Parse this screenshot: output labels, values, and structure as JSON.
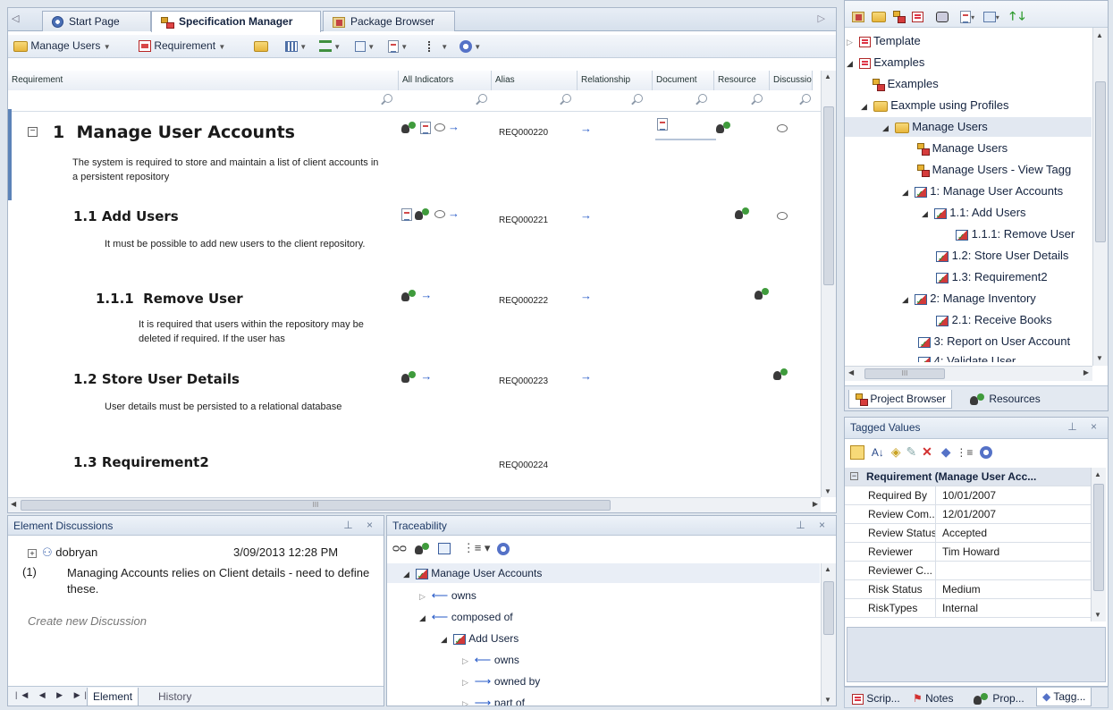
{
  "doc_tabs": {
    "start_page": "Start Page",
    "spec_manager": "Specification Manager",
    "package_browser": "Package Browser"
  },
  "spec_toolbar": {
    "manage_users": "Manage Users",
    "requirement": "Requirement"
  },
  "columns": {
    "requirement": "Requirement",
    "all_indicators": "All Indicators",
    "alias": "Alias",
    "relationship": "Relationship",
    "document": "Document",
    "resource": "Resource",
    "discussion": "Discussio"
  },
  "requirements": [
    {
      "number": "1",
      "title": "Manage User Accounts",
      "description": "The system is required to store and maintain a list of client accounts in a persistent repository",
      "alias": "REQ000220"
    },
    {
      "number": "1.1",
      "title": "Add Users",
      "description": "It must be possible to add new users to the client repository.",
      "alias": "REQ000221"
    },
    {
      "number": "1.1.1",
      "title": "Remove User",
      "description": "It is required that users within the repository may be deleted if required. If the user has",
      "alias": "REQ000222"
    },
    {
      "number": "1.2",
      "title": "Store User Details",
      "description": "User details must be persisted to a relational database",
      "alias": "REQ000223"
    },
    {
      "number": "1.3",
      "title": "Requirement2",
      "description": "",
      "alias": "REQ000224"
    }
  ],
  "discussions": {
    "title": "Element Discussions",
    "author": "dobryan",
    "date": "3/09/2013 12:28 PM",
    "index": "(1)",
    "message": "Managing Accounts relies on Client details - need to define these.",
    "create_new": "Create new Discussion",
    "tab_element": "Element",
    "tab_history": "History"
  },
  "traceability": {
    "title": "Traceability",
    "root": "Manage User Accounts",
    "items": [
      "owns",
      "composed of",
      "Add Users",
      "owns",
      "owned by",
      "part of"
    ]
  },
  "project_browser": {
    "items": [
      {
        "label": "Template"
      },
      {
        "label": "Examples"
      },
      {
        "label": "Examples"
      },
      {
        "label": "Eaxmple using Profiles"
      },
      {
        "label": "Manage Users"
      },
      {
        "label": "Manage Users"
      },
      {
        "label": "Manage Users - View Tagg"
      },
      {
        "label": "1: Manage User Accounts"
      },
      {
        "label": "1.1: Add Users"
      },
      {
        "label": "1.1.1: Remove User"
      },
      {
        "label": "1.2: Store User Details"
      },
      {
        "label": "1.3: Requirement2"
      },
      {
        "label": "2: Manage Inventory"
      },
      {
        "label": "2.1: Receive Books"
      },
      {
        "label": "3: Report on User Account"
      },
      {
        "label": "4: Validate User"
      }
    ],
    "tab_project_browser": "Project Browser",
    "tab_resources": "Resources",
    "scroll_label": "III"
  },
  "tagged_values": {
    "title": "Tagged Values",
    "group": "Requirement  (Manage User Acc...",
    "rows": [
      {
        "key": "Required By",
        "value": "10/01/2007"
      },
      {
        "key": "Review Com...",
        "value": "12/01/2007"
      },
      {
        "key": "Review Status",
        "value": "Accepted"
      },
      {
        "key": "Reviewer",
        "value": "Tim Howard"
      },
      {
        "key": "Reviewer C...",
        "value": ""
      },
      {
        "key": "Risk Status",
        "value": "Medium"
      },
      {
        "key": "RiskTypes",
        "value": "Internal"
      }
    ]
  },
  "bottom_tabs": {
    "scripts": "Scrip...",
    "notes": "Notes",
    "properties": "Prop...",
    "tagged": "Tagg..."
  },
  "hscroll_label": "III"
}
